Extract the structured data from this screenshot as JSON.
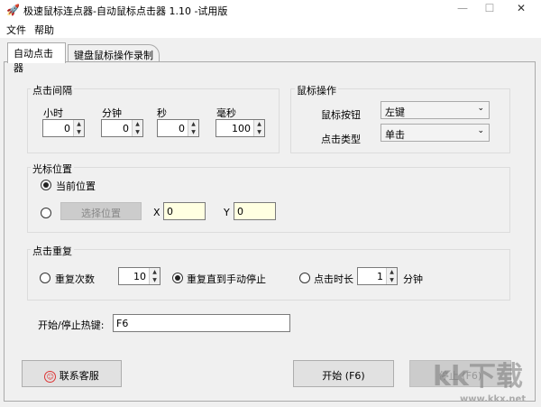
{
  "window": {
    "title": "极速鼠标连点器-自动鼠标点击器 1.10  -试用版",
    "minimize": "—",
    "maximize": "☐",
    "close": "✕"
  },
  "menu": [
    "文件",
    "帮助"
  ],
  "tabs": [
    "自动点击器",
    "键盘鼠标操作录制"
  ],
  "interval": {
    "label": "点击间隔",
    "fields": [
      {
        "label": "小时",
        "value": "0"
      },
      {
        "label": "分钟",
        "value": "0"
      },
      {
        "label": "秒",
        "value": "0"
      },
      {
        "label": "毫秒",
        "value": "100"
      }
    ]
  },
  "mouse": {
    "label": "鼠标操作",
    "button_label": "鼠标按钮",
    "button_value": "左键",
    "type_label": "点击类型",
    "type_value": "单击"
  },
  "cursor": {
    "label": "光标位置",
    "current": "当前位置",
    "select_button": "选择位置",
    "x_label": "X",
    "x_value": "0",
    "y_label": "Y",
    "y_value": "0"
  },
  "repeat": {
    "label": "点击重复",
    "times_label": "重复次数",
    "times_value": "10",
    "until_stop": "重复直到手动停止",
    "duration_label": "点击时长",
    "duration_value": "1",
    "duration_unit": "分钟"
  },
  "hotkey": {
    "label": "开始/停止热键:",
    "value": "F6"
  },
  "buttons": {
    "contact": "联系客服",
    "start": "开始 (F6)",
    "stop": "停止 (F6)"
  },
  "watermark": {
    "text": "kk下载",
    "url": "www.kkx.net"
  }
}
